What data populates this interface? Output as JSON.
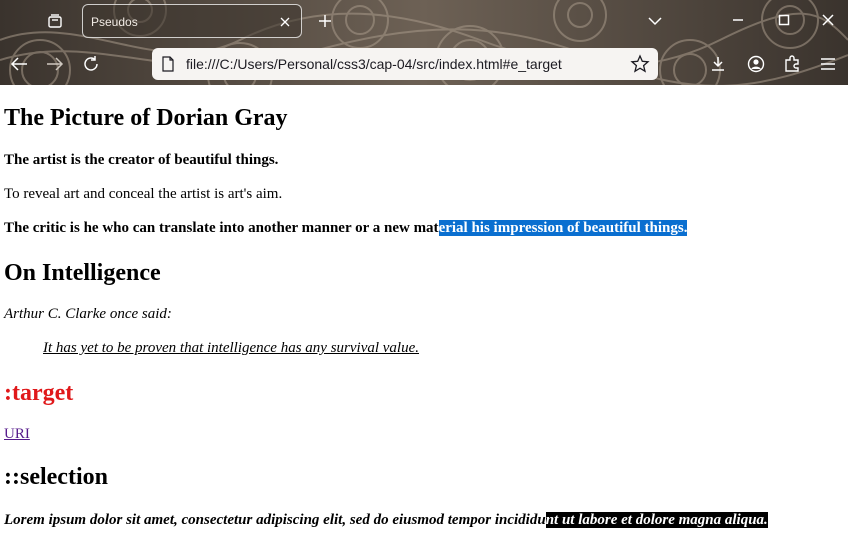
{
  "browser": {
    "tab_title": "Pseudos",
    "url": "file:///C:/Users/Personal/css3/cap-04/src/index.html#e_target"
  },
  "content": {
    "h_dorian": "The Picture of Dorian Gray",
    "p1": "The artist is the creator of beautiful things.",
    "p2": "To reveal art and conceal the artist is art's aim.",
    "p3_before": "The critic is he who can translate into another manner or a new mat",
    "p3_selected": "erial his impression of beautiful things.",
    "h_intel": "On Intelligence",
    "clarke": "Arthur C. Clarke once said:",
    "quote": "It has yet to be proven that intelligence has any survival value.",
    "h_target": ":target",
    "uri_link": "URI",
    "h_selection": "::selection",
    "lorem_before": "Lorem ipsum dolor sit amet, consectetur adipiscing elit, sed do eiusmod tempor incididu",
    "lorem_selected": "nt ut labore et dolore magna aliqua."
  },
  "colors": {
    "target_heading": "#e0181a",
    "link_visited": "#551a8b",
    "selection_blue": "#0a6fd0",
    "selection_black": "#000000"
  },
  "icons": [
    "tab-list-icon",
    "close-icon",
    "plus-icon",
    "chevron-down-icon",
    "minimize-icon",
    "maximize-icon",
    "window-close-icon",
    "back-arrow-icon",
    "forward-arrow-icon",
    "reload-icon",
    "page-icon",
    "star-icon",
    "download-icon",
    "account-icon",
    "extensions-icon",
    "menu-icon"
  ]
}
